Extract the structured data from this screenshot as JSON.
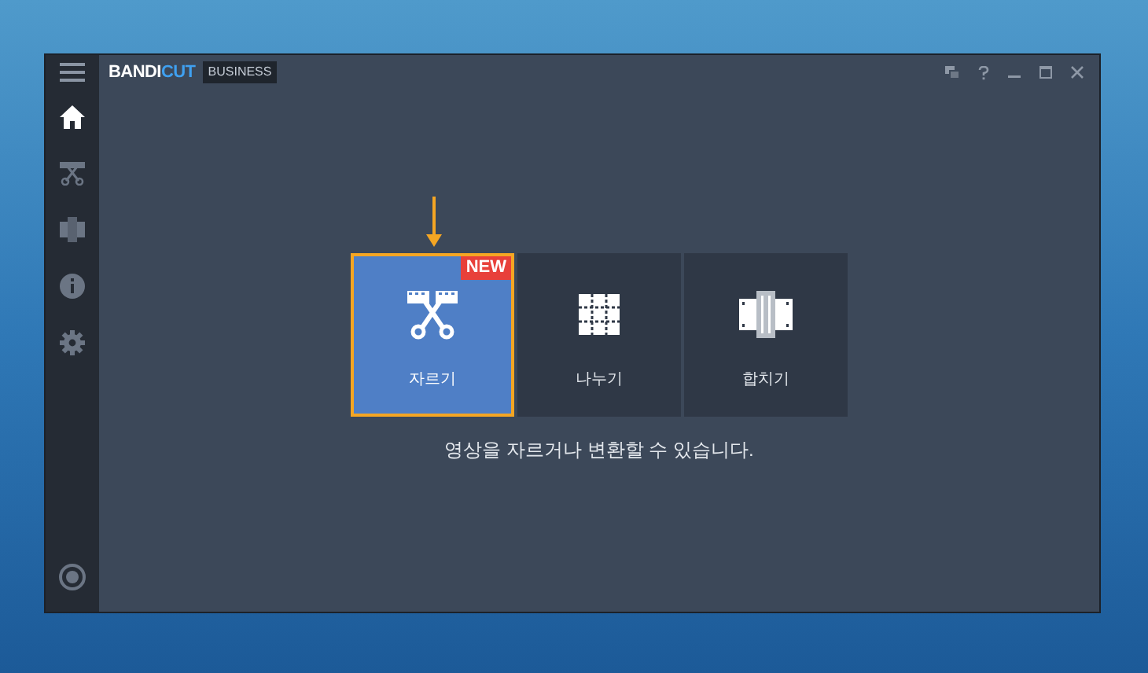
{
  "window": {
    "brand": {
      "primary": "BANDI",
      "accent": "CUT"
    },
    "edition": "BUSINESS"
  },
  "sidebar": {
    "items": [
      {
        "kind": "home",
        "selected": true
      },
      {
        "kind": "cut",
        "selected": false
      },
      {
        "kind": "join",
        "selected": false
      },
      {
        "kind": "info",
        "selected": false
      },
      {
        "kind": "settings",
        "selected": false
      }
    ]
  },
  "tiles": [
    {
      "kind": "cut",
      "label": "자르기",
      "selected": true,
      "badge": "NEW"
    },
    {
      "kind": "split",
      "label": "나누기",
      "selected": false
    },
    {
      "kind": "join",
      "label": "합치기",
      "selected": false
    }
  ],
  "description": "영상을 자르거나 변환할 수 있습니다."
}
